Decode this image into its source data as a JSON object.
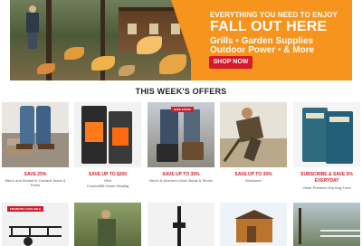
{
  "hero": {
    "tagline": "EVERYTHING YOU NEED TO ENJOY",
    "headline": "FALL OUT HERE",
    "line1": "Grills • Garden Supplies",
    "line2": "Outdoor Power • & More",
    "cta": "SHOP NOW"
  },
  "section": {
    "title": "THIS WEEK'S OFFERS"
  },
  "offers": [
    {
      "title": "SAVE 25%",
      "subtitle": "Men's and Women's Carhartt Jeans & Pants"
    },
    {
      "title": "SAVE UP TO $200",
      "subtitle_brand": "Vitre",
      "subtitle": "ComfortBilt Home Heating"
    },
    {
      "title": "SAVE UP TO 30%",
      "subtitle": "Men's & Women's Work Boots & Shoes",
      "badge": "SAVE EXTRA"
    },
    {
      "title": "SAVE UP TO 30%",
      "subtitle": "Workwear"
    },
    {
      "title": "SUBSCRIBE & SAVE 5%",
      "title2": "EVERYDAY",
      "subtitle": "Victor Premium Dry Dog Food"
    }
  ],
  "row2": [
    {
      "badge": "FINANCING AVAILABLE"
    },
    {},
    {},
    {},
    {}
  ],
  "colors": {
    "accent": "#f7941d",
    "sale": "#cc1f2d",
    "cta": "#d7192a"
  }
}
